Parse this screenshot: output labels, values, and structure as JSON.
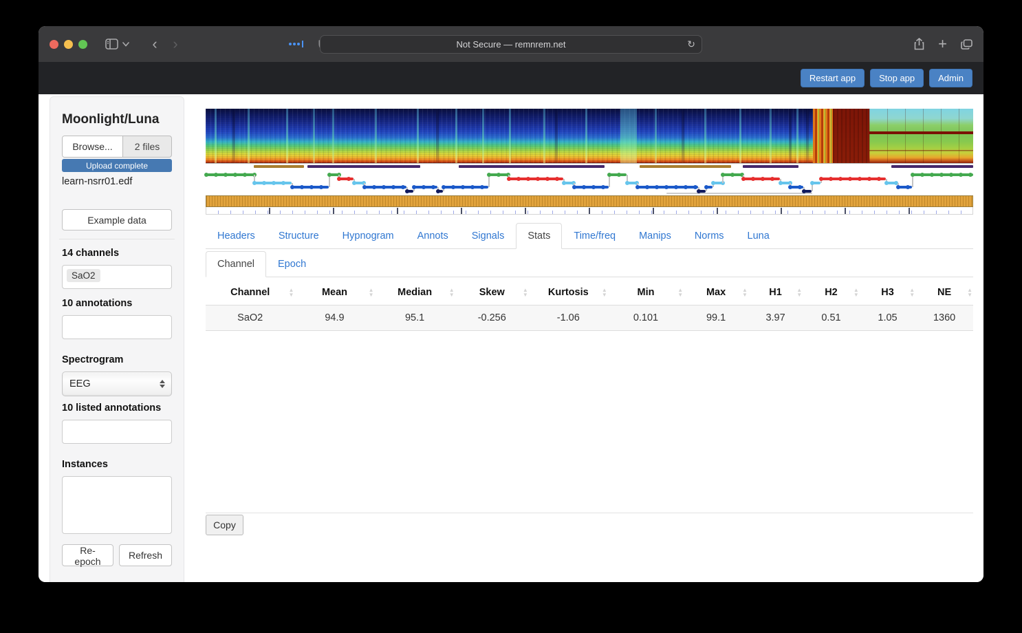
{
  "browser": {
    "url_text": "Not Secure — remnrem.net",
    "reload_glyph": "↻",
    "back_glyph": "‹",
    "forward_glyph": "›",
    "plus_glyph": "+"
  },
  "app_header": {
    "buttons": [
      "Restart app",
      "Stop app",
      "Admin"
    ]
  },
  "sidebar": {
    "title": "Moonlight/Luna",
    "browse_label": "Browse...",
    "files_label": "2 files",
    "upload_status": "Upload complete",
    "filename": "learn-nsrr01.edf",
    "example_button": "Example data",
    "channels_label": "14 channels",
    "channel_tag": "SaO2",
    "annotations_label": "10 annotations",
    "spectrogram_label": "Spectrogram",
    "spectrogram_selected": "EEG",
    "listed_annotations_label": "10 listed annotations",
    "instances_label": "Instances",
    "reepoch_button": "Re-epoch",
    "refresh_button": "Refresh"
  },
  "tabs": [
    {
      "label": "Headers",
      "active": false
    },
    {
      "label": "Structure",
      "active": false
    },
    {
      "label": "Hypnogram",
      "active": false
    },
    {
      "label": "Annots",
      "active": false
    },
    {
      "label": "Signals",
      "active": false
    },
    {
      "label": "Stats",
      "active": true
    },
    {
      "label": "Time/freq",
      "active": false
    },
    {
      "label": "Manips",
      "active": false
    },
    {
      "label": "Norms",
      "active": false
    },
    {
      "label": "Luna",
      "active": false
    }
  ],
  "subtabs": [
    {
      "label": "Channel",
      "active": true
    },
    {
      "label": "Epoch",
      "active": false
    }
  ],
  "stats_table": {
    "columns": [
      "Channel",
      "Mean",
      "Median",
      "Skew",
      "Kurtosis",
      "Min",
      "Max",
      "H1",
      "H2",
      "H3",
      "NE"
    ],
    "col_widths_pct": [
      11.6,
      10.4,
      10.5,
      9.6,
      10.3,
      9.9,
      8.4,
      7.1,
      7.4,
      7.3,
      7.5
    ],
    "rows": [
      [
        "SaO2",
        "94.9",
        "95.1",
        "-0.256",
        "-1.06",
        "0.101",
        "99.1",
        "3.97",
        "0.51",
        "1.05",
        "1360"
      ]
    ]
  },
  "footer": {
    "copy_button": "Copy"
  },
  "colors": {
    "header_button_blue": "#4a82c4",
    "progress_blue": "#4679b2",
    "tab_link_blue": "#3077d1",
    "annot_brown": "#a87d2e",
    "annot_purple": "#44276b"
  },
  "viz": {
    "annotation_bars": [
      {
        "color": "#a87d2e",
        "a": 0.063,
        "b": 0.128
      },
      {
        "color": "#44276b",
        "a": 0.133,
        "b": 0.28
      },
      {
        "color": "#44276b",
        "a": 0.33,
        "b": 0.52
      },
      {
        "color": "#a87d2e",
        "a": 0.565,
        "b": 0.685
      },
      {
        "color": "#44276b",
        "a": 0.7,
        "b": 0.772
      },
      {
        "color": "#44276b",
        "a": 0.893,
        "b": 1.0
      }
    ],
    "hypnogram": {
      "levels": {
        "W": 6,
        "R": 12,
        "N1": 18,
        "N2": 24,
        "N3": 30,
        "L": 34
      },
      "stage_colors": {
        "W": "#44a94f",
        "R": "#e62f2f",
        "N1": "#66c5ec",
        "N2": "#1b59c9",
        "N3": "#101a5e",
        "L": "#cccccc"
      },
      "segments": [
        [
          "W",
          0.0,
          0.063
        ],
        [
          "N1",
          0.063,
          0.112
        ],
        [
          "N2",
          0.112,
          0.16
        ],
        [
          "W",
          0.16,
          0.173
        ],
        [
          "R",
          0.173,
          0.193
        ],
        [
          "N1",
          0.193,
          0.206
        ],
        [
          "N2",
          0.206,
          0.262
        ],
        [
          "N3",
          0.262,
          0.271
        ],
        [
          "N2",
          0.271,
          0.302
        ],
        [
          "N3",
          0.302,
          0.309
        ],
        [
          "N2",
          0.309,
          0.368
        ],
        [
          "W",
          0.368,
          0.394
        ],
        [
          "R",
          0.394,
          0.466
        ],
        [
          "N1",
          0.466,
          0.479
        ],
        [
          "N2",
          0.479,
          0.525
        ],
        [
          "W",
          0.525,
          0.548
        ],
        [
          "N1",
          0.548,
          0.562
        ],
        [
          "N2",
          0.562,
          0.642
        ],
        [
          "N3",
          0.642,
          0.651
        ],
        [
          "N2",
          0.651,
          0.66
        ],
        [
          "N1",
          0.66,
          0.673
        ],
        [
          "W",
          0.673,
          0.7
        ],
        [
          "R",
          0.7,
          0.748
        ],
        [
          "N1",
          0.748,
          0.761
        ],
        [
          "N2",
          0.761,
          0.779
        ],
        [
          "N3",
          0.779,
          0.789
        ],
        [
          "N1",
          0.789,
          0.801
        ],
        [
          "R",
          0.801,
          0.886
        ],
        [
          "N1",
          0.886,
          0.901
        ],
        [
          "N2",
          0.901,
          0.92
        ],
        [
          "W",
          0.92,
          1.0
        ]
      ],
      "extra_lines": [
        {
          "stage": "L",
          "a": 0.6,
          "b": 0.79
        }
      ]
    },
    "spectrogram_streaks": {
      "bright_pct": [
        1.2,
        5.5,
        10.5,
        14,
        16.5,
        22,
        27.5,
        32.5,
        36,
        39.5,
        44,
        49.5,
        58.5,
        65,
        69.5,
        73.5,
        77
      ],
      "bright_wide_pct": [
        54
      ],
      "dark_pct": [
        3.5,
        30,
        45.5,
        62,
        76,
        78.2
      ]
    }
  }
}
